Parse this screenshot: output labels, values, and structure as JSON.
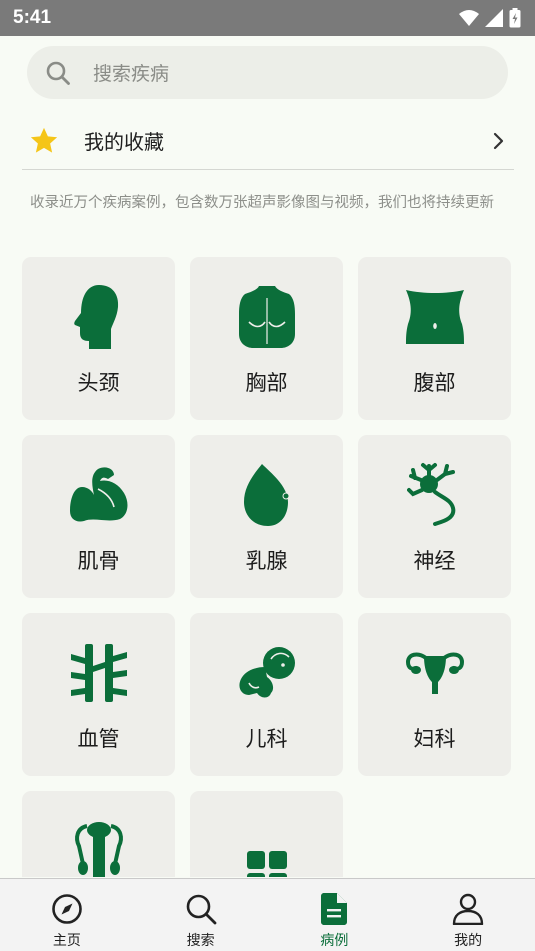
{
  "status_bar": {
    "time": "5:41"
  },
  "search": {
    "placeholder": "搜索疾病"
  },
  "favorites": {
    "label": "我的收藏"
  },
  "description": "收录近万个疾病案例，包含数万张超声影像图与视频，我们也将持续更新",
  "colors": {
    "brand_green": "#0b6e3a",
    "star_yellow": "#f5c518",
    "tile_bg": "#eeeeea"
  },
  "categories": [
    {
      "label": "头颈",
      "icon": "head-icon"
    },
    {
      "label": "胸部",
      "icon": "chest-icon"
    },
    {
      "label": "腹部",
      "icon": "abdomen-icon"
    },
    {
      "label": "肌骨",
      "icon": "muscle-icon"
    },
    {
      "label": "乳腺",
      "icon": "breast-icon"
    },
    {
      "label": "神经",
      "icon": "neuron-icon"
    },
    {
      "label": "血管",
      "icon": "vessel-icon"
    },
    {
      "label": "儿科",
      "icon": "baby-icon"
    },
    {
      "label": "妇科",
      "icon": "uterus-icon"
    },
    {
      "label": "",
      "icon": "male-reproductive-icon"
    },
    {
      "label": "",
      "icon": "grid-more-icon"
    }
  ],
  "bottom_nav": [
    {
      "label": "主页",
      "icon": "compass-icon",
      "active": false
    },
    {
      "label": "搜索",
      "icon": "search-icon",
      "active": false
    },
    {
      "label": "病例",
      "icon": "document-icon",
      "active": true
    },
    {
      "label": "我的",
      "icon": "person-icon",
      "active": false
    }
  ]
}
